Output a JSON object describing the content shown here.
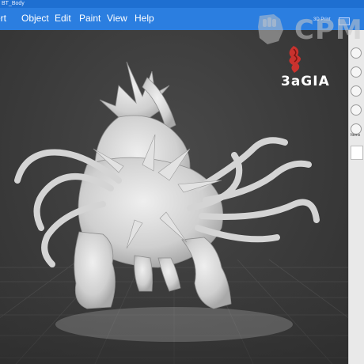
{
  "window": {
    "title_fragment": "BT_Body"
  },
  "menu": {
    "items": [
      "ert",
      "Object",
      "Edit",
      "Paint",
      "View",
      "Help"
    ]
  },
  "toolbar": {
    "top_right_label": "3D Print"
  },
  "panel": {
    "label": "Items"
  },
  "watermark": {
    "text": "CPM"
  },
  "brand": {
    "text": "3aGIA"
  },
  "colors": {
    "menubar": "#2b7ee0",
    "viewport": "#3b3b3b",
    "model": "#d8d8d8",
    "panel": "#e9e9e9"
  }
}
